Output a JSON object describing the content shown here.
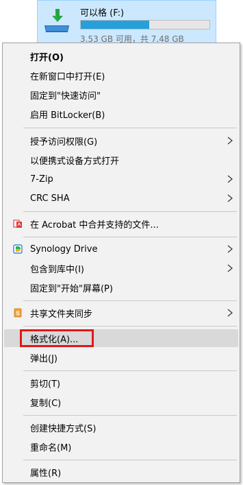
{
  "drive": {
    "name": "可以格 (F:)",
    "space": "3.53 GB 可用，共 7.48 GB",
    "used_fraction": 0.53
  },
  "menu": {
    "open": "打开(O)",
    "open_new_window": "在新窗口中打开(E)",
    "pin_quick_access": "固定到\"快速访问\"",
    "bitlocker": "启用 BitLocker(B)",
    "grant_access": "授予访问权限(G)",
    "open_portable": "以便携式设备方式打开",
    "seven_zip": "7-Zip",
    "crc_sha": "CRC SHA",
    "acrobat_combine": "在 Acrobat 中合并支持的文件...",
    "synology_drive": "Synology Drive",
    "include_library": "包含到库中(I)",
    "pin_start": "固定到\"开始\"屏幕(P)",
    "share_sync": "共享文件夹同步",
    "format": "格式化(A)...",
    "eject": "弹出(J)",
    "cut": "剪切(T)",
    "copy": "复制(C)",
    "create_shortcut": "创建快捷方式(S)",
    "rename": "重命名(M)",
    "properties": "属性(R)"
  },
  "colors": {
    "menu_bg": "#f2f2f2",
    "highlight": "#d9d9d9",
    "red_outline": "#e01717",
    "drive_bar": "#26a0da"
  },
  "icons": [
    "drive-icon",
    "chevron-right-icon",
    "acrobat-icon",
    "synology-drive-icon",
    "sync-icon"
  ]
}
